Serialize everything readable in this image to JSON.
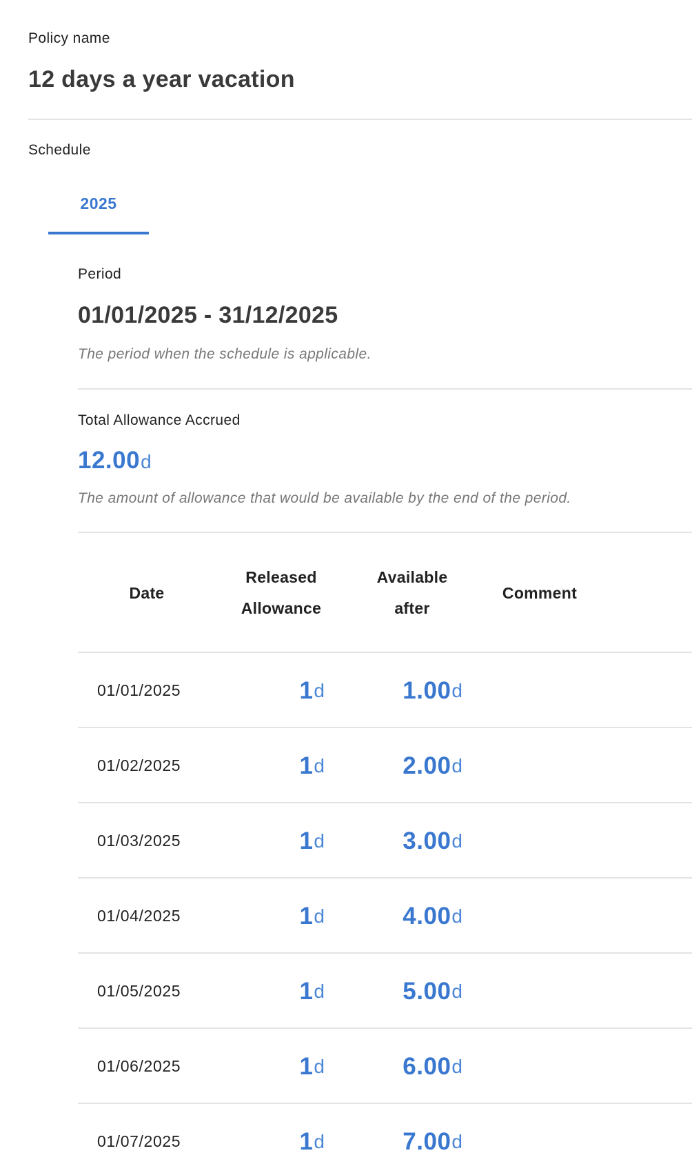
{
  "policy": {
    "label": "Policy name",
    "value": "12 days a year vacation"
  },
  "schedule": {
    "label": "Schedule",
    "tabs": [
      {
        "label": "2025",
        "active": true
      }
    ]
  },
  "period": {
    "label": "Period",
    "value": "01/01/2025 - 31/12/2025",
    "help": "The period when the schedule is applicable."
  },
  "total_allowance": {
    "label": "Total Allowance Accrued",
    "value": "12.00",
    "unit": "d",
    "help": "The amount of allowance that would be available by the end of the period."
  },
  "table": {
    "headers": {
      "date": "Date",
      "released_line1": "Released",
      "released_line2": "Allowance",
      "available_line1": "Available",
      "available_line2": "after",
      "comment": "Comment"
    },
    "unit": "d",
    "rows": [
      {
        "date": "01/01/2025",
        "released": "1",
        "available": "1.00",
        "comment": ""
      },
      {
        "date": "01/02/2025",
        "released": "1",
        "available": "2.00",
        "comment": ""
      },
      {
        "date": "01/03/2025",
        "released": "1",
        "available": "3.00",
        "comment": ""
      },
      {
        "date": "01/04/2025",
        "released": "1",
        "available": "4.00",
        "comment": ""
      },
      {
        "date": "01/05/2025",
        "released": "1",
        "available": "5.00",
        "comment": ""
      },
      {
        "date": "01/06/2025",
        "released": "1",
        "available": "6.00",
        "comment": ""
      },
      {
        "date": "01/07/2025",
        "released": "1",
        "available": "7.00",
        "comment": ""
      }
    ]
  },
  "colors": {
    "accent": "#3a78d0",
    "divider": "#e3e3e3",
    "help_text": "#777777"
  }
}
